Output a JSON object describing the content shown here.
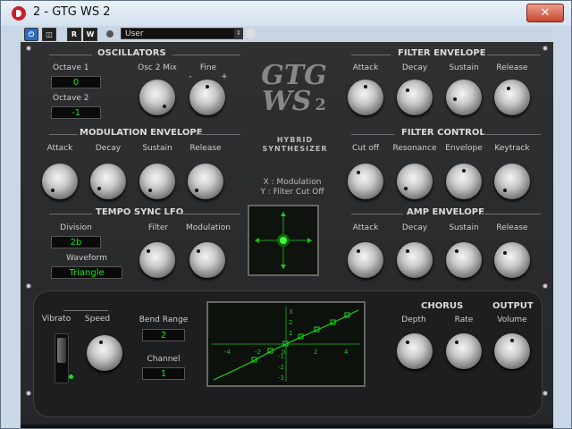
{
  "window": {
    "title": "2 - GTG WS 2",
    "close_label": "✕"
  },
  "toolbar": {
    "power_label": "⏻",
    "btn1_label": "◫",
    "r_label": "R",
    "w_label": "W",
    "preset_value": "User",
    "preset_arrow": "⇕"
  },
  "logo": {
    "line1": "GTG",
    "line2": "WS",
    "version": "2",
    "subtitle_1": "HYBRID",
    "subtitle_2": "SYNTHESIZER"
  },
  "xy": {
    "x_label": "X : Modulation",
    "y_label": "Y : Filter Cut Off"
  },
  "oscillators": {
    "header": "OSCILLATORS",
    "octave1_label": "Octave 1",
    "octave1_value": "0",
    "octave2_label": "Octave 2",
    "octave2_value": "-1",
    "osc2mix_label": "Osc 2 Mix",
    "fine_label": "Fine",
    "fine_minus": "-",
    "fine_plus": "+"
  },
  "mod_env": {
    "header": "MODULATION ENVELOPE",
    "labels": [
      "Attack",
      "Decay",
      "Sustain",
      "Release"
    ]
  },
  "lfo": {
    "header": "TEMPO SYNC LFO",
    "division_label": "Division",
    "division_value": "2b",
    "waveform_label": "Waveform",
    "waveform_value": "Triangle",
    "filter_label": "Filter",
    "modulation_label": "Modulation"
  },
  "filter_env": {
    "header": "FILTER ENVELOPE",
    "labels": [
      "Attack",
      "Decay",
      "Sustain",
      "Release"
    ]
  },
  "filter_ctrl": {
    "header": "FILTER CONTROL",
    "labels": [
      "Cut off",
      "Resonance",
      "Envelope",
      "Keytrack"
    ]
  },
  "amp_env": {
    "header": "AMP ENVELOPE",
    "labels": [
      "Attack",
      "Decay",
      "Sustain",
      "Release"
    ]
  },
  "lower": {
    "vibrato_label": "Vibrato",
    "speed_label": "Speed",
    "bend_range_label": "Bend Range",
    "bend_range_value": "2",
    "channel_label": "Channel",
    "channel_value": "1",
    "chorus_header": "CHORUS",
    "depth_label": "Depth",
    "rate_label": "Rate",
    "output_header": "OUTPUT",
    "volume_label": "Volume"
  },
  "graph": {
    "x_ticks": [
      "-4",
      "-2",
      "0",
      "2",
      "4"
    ],
    "y_ticks": [
      "3",
      "2",
      "1",
      "-1",
      "-2",
      "-3"
    ],
    "line_color": "#19d81c"
  }
}
